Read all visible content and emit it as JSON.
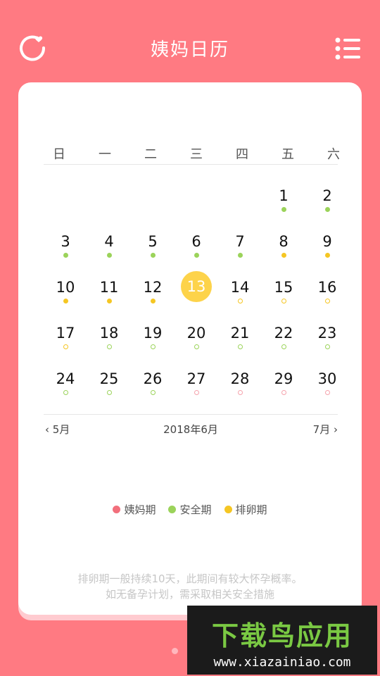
{
  "header": {
    "title": "姨妈日历"
  },
  "weekdays": [
    "日",
    "一",
    "二",
    "三",
    "四",
    "五",
    "六"
  ],
  "days": [
    {
      "n": "",
      "m": "none"
    },
    {
      "n": "",
      "m": "none"
    },
    {
      "n": "",
      "m": "none"
    },
    {
      "n": "",
      "m": "none"
    },
    {
      "n": "",
      "m": "none"
    },
    {
      "n": "1",
      "m": "green"
    },
    {
      "n": "2",
      "m": "green"
    },
    {
      "n": "3",
      "m": "green"
    },
    {
      "n": "4",
      "m": "green"
    },
    {
      "n": "5",
      "m": "green"
    },
    {
      "n": "6",
      "m": "green"
    },
    {
      "n": "7",
      "m": "green"
    },
    {
      "n": "8",
      "m": "yellow"
    },
    {
      "n": "9",
      "m": "yellow"
    },
    {
      "n": "10",
      "m": "yellow"
    },
    {
      "n": "11",
      "m": "yellow"
    },
    {
      "n": "12",
      "m": "yellow"
    },
    {
      "n": "13",
      "m": "today"
    },
    {
      "n": "14",
      "m": "ring-yellow"
    },
    {
      "n": "15",
      "m": "ring-yellow"
    },
    {
      "n": "16",
      "m": "ring-yellow"
    },
    {
      "n": "17",
      "m": "ring-yellow"
    },
    {
      "n": "18",
      "m": "ring-green"
    },
    {
      "n": "19",
      "m": "ring-green"
    },
    {
      "n": "20",
      "m": "ring-green"
    },
    {
      "n": "21",
      "m": "ring-green"
    },
    {
      "n": "22",
      "m": "ring-green"
    },
    {
      "n": "23",
      "m": "ring-green"
    },
    {
      "n": "24",
      "m": "ring-green"
    },
    {
      "n": "25",
      "m": "ring-green"
    },
    {
      "n": "26",
      "m": "ring-green"
    },
    {
      "n": "27",
      "m": "ring-pink"
    },
    {
      "n": "28",
      "m": "ring-pink"
    },
    {
      "n": "29",
      "m": "ring-pink"
    },
    {
      "n": "30",
      "m": "ring-pink"
    }
  ],
  "nav": {
    "prev": "5月",
    "current": "2018年6月",
    "next": "7月"
  },
  "legend": [
    {
      "label": "姨妈期",
      "color": "#F26F7C"
    },
    {
      "label": "安全期",
      "color": "#9BD35A"
    },
    {
      "label": "排卵期",
      "color": "#F5C623"
    }
  ],
  "note": {
    "line1": "排卵期一般持续10天，此期间有较大怀孕概率。",
    "line2": "如无备孕计划，需采取相关安全措施"
  },
  "watermark": {
    "brand": "下载鸟应用",
    "url": "www.xiazainiao.com"
  },
  "icons": {
    "refresh": "refresh-heart-icon",
    "menu": "list-menu-icon"
  }
}
